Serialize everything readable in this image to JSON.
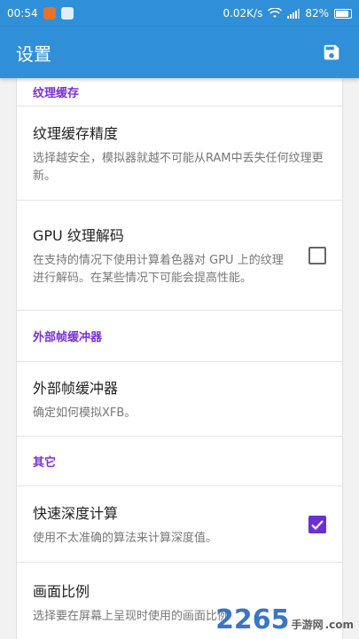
{
  "status_bar": {
    "time": "00:54",
    "network_speed": "0.02K/s",
    "signal_type": "4G",
    "battery": "82%"
  },
  "app_bar": {
    "title": "设置",
    "save_icon": "save-icon"
  },
  "sections": [
    {
      "header": "纹理缓存",
      "items": [
        {
          "title": "纹理缓存精度",
          "summary": "选择越安全，模拟器就越不可能从RAM中丢失任何纹理更新。"
        },
        {
          "title": "GPU 纹理解码",
          "summary": "在支持的情况下使用计算着色器对 GPU 上的纹理进行解码。在某些情况下可能会提高性能。",
          "checked": false
        }
      ]
    },
    {
      "header": "外部帧缓冲器",
      "items": [
        {
          "title": "外部帧缓冲器",
          "summary": "确定如何模拟XFB。"
        }
      ]
    },
    {
      "header": "其它",
      "items": [
        {
          "title": "快速深度计算",
          "summary": "使用不太准确的算法来计算深度值。",
          "checked": true
        },
        {
          "title": "画面比例",
          "summary": "选择要在屏幕上呈现时使用的画面比例"
        }
      ]
    }
  ],
  "watermark": {
    "brand": "2265",
    "suffix": "手游网",
    "url": ".com"
  },
  "colors": {
    "primary": "#2f8fd8",
    "accent": "#6a2fd6",
    "section_header": "#7b2fd6"
  }
}
